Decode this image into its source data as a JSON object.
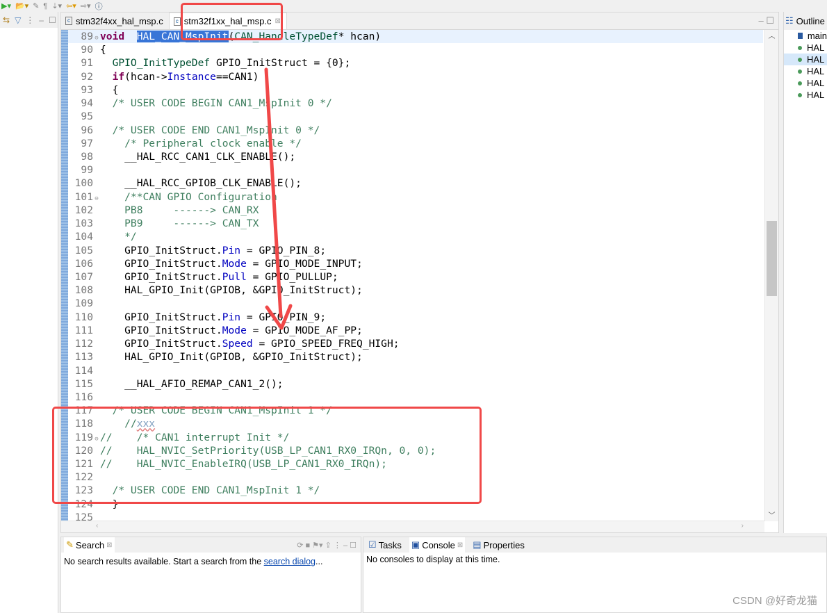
{
  "editor": {
    "tabs": [
      {
        "label": "stm32f4xx_hal_msp.c",
        "active": false
      },
      {
        "label": "stm32f1xx_hal_msp.c",
        "active": true
      }
    ],
    "current_line": 89,
    "lines": [
      {
        "n": "89",
        "fold": true,
        "t": [
          [
            "kw",
            "void"
          ],
          [
            "",
            "  "
          ],
          [
            "sel",
            "HAL_CAN_MspInit"
          ],
          [
            "",
            "("
          ],
          [
            "typ",
            "CAN_HandleTypeDef"
          ],
          [
            "",
            "* hcan)"
          ]
        ]
      },
      {
        "n": "90",
        "t": [
          [
            "",
            "{"
          ]
        ]
      },
      {
        "n": "91",
        "t": [
          [
            "",
            "  "
          ],
          [
            "typ",
            "GPIO_InitTypeDef"
          ],
          [
            "",
            " GPIO_InitStruct = {0};"
          ]
        ]
      },
      {
        "n": "92",
        "t": [
          [
            "",
            "  "
          ],
          [
            "kw",
            "if"
          ],
          [
            "",
            "(hcan->"
          ],
          [
            "fld",
            "Instance"
          ],
          [
            "",
            "==CAN1)"
          ]
        ]
      },
      {
        "n": "93",
        "t": [
          [
            "",
            "  {"
          ]
        ]
      },
      {
        "n": "94",
        "t": [
          [
            "",
            "  "
          ],
          [
            "cm",
            "/* USER CODE BEGIN CAN1_MspInit 0 */"
          ]
        ]
      },
      {
        "n": "95",
        "t": []
      },
      {
        "n": "96",
        "t": [
          [
            "",
            "  "
          ],
          [
            "cm",
            "/* USER CODE END CAN1_MspInit 0 */"
          ]
        ]
      },
      {
        "n": "97",
        "t": [
          [
            "",
            "    "
          ],
          [
            "cm",
            "/* Peripheral clock enable */"
          ]
        ]
      },
      {
        "n": "98",
        "t": [
          [
            "",
            "    __HAL_RCC_CAN1_CLK_ENABLE();"
          ]
        ]
      },
      {
        "n": "99",
        "t": []
      },
      {
        "n": "100",
        "t": [
          [
            "",
            "    __HAL_RCC_GPIOB_CLK_ENABLE();"
          ]
        ]
      },
      {
        "n": "101",
        "fold": true,
        "t": [
          [
            "",
            "    "
          ],
          [
            "cm",
            "/**CAN GPIO Configuration"
          ]
        ]
      },
      {
        "n": "102",
        "t": [
          [
            "cm",
            "    PB8     ------> CAN_RX"
          ]
        ]
      },
      {
        "n": "103",
        "t": [
          [
            "cm",
            "    PB9     ------> CAN_TX"
          ]
        ]
      },
      {
        "n": "104",
        "t": [
          [
            "cm",
            "    */"
          ]
        ]
      },
      {
        "n": "105",
        "t": [
          [
            "",
            "    GPIO_InitStruct."
          ],
          [
            "fld",
            "Pin"
          ],
          [
            "",
            " = GPIO_PIN_8;"
          ]
        ]
      },
      {
        "n": "106",
        "t": [
          [
            "",
            "    GPIO_InitStruct."
          ],
          [
            "fld",
            "Mode"
          ],
          [
            "",
            " = GPIO_MODE_INPUT;"
          ]
        ]
      },
      {
        "n": "107",
        "t": [
          [
            "",
            "    GPIO_InitStruct."
          ],
          [
            "fld",
            "Pull"
          ],
          [
            "",
            " = GPIO_PULLUP;"
          ]
        ]
      },
      {
        "n": "108",
        "t": [
          [
            "",
            "    HAL_GPIO_Init(GPIOB, &GPIO_InitStruct);"
          ]
        ]
      },
      {
        "n": "109",
        "t": []
      },
      {
        "n": "110",
        "t": [
          [
            "",
            "    GPIO_InitStruct."
          ],
          [
            "fld",
            "Pin"
          ],
          [
            "",
            " = GPIO_PIN_9;"
          ]
        ]
      },
      {
        "n": "111",
        "t": [
          [
            "",
            "    GPIO_InitStruct."
          ],
          [
            "fld",
            "Mode"
          ],
          [
            "",
            " = GPIO_MODE_AF_PP;"
          ]
        ]
      },
      {
        "n": "112",
        "t": [
          [
            "",
            "    GPIO_InitStruct."
          ],
          [
            "fld",
            "Speed"
          ],
          [
            "",
            " = GPIO_SPEED_FREQ_HIGH;"
          ]
        ]
      },
      {
        "n": "113",
        "t": [
          [
            "",
            "    HAL_GPIO_Init(GPIOB, &GPIO_InitStruct);"
          ]
        ]
      },
      {
        "n": "114",
        "t": []
      },
      {
        "n": "115",
        "t": [
          [
            "",
            "    __HAL_AFIO_REMAP_CAN1_2();"
          ]
        ]
      },
      {
        "n": "116",
        "t": []
      },
      {
        "n": "117",
        "t": [
          [
            "",
            "  "
          ],
          [
            "cm",
            "/* USER CODE BEGIN CAN1_MspInit 1 */"
          ]
        ]
      },
      {
        "n": "118",
        "t": [
          [
            "",
            "    "
          ],
          [
            "cm",
            "//"
          ],
          [
            "task",
            "xxx"
          ]
        ]
      },
      {
        "n": "119",
        "fold": true,
        "t": [
          [
            "cm",
            "//    /* CAN1 interrupt Init */"
          ]
        ]
      },
      {
        "n": "120",
        "t": [
          [
            "cm",
            "//    HAL_NVIC_SetPriority(USB_LP_CAN1_RX0_IRQn, 0, 0);"
          ]
        ]
      },
      {
        "n": "121",
        "t": [
          [
            "cm",
            "//    HAL_NVIC_EnableIRQ(USB_LP_CAN1_RX0_IRQn);"
          ]
        ]
      },
      {
        "n": "122",
        "t": []
      },
      {
        "n": "123",
        "t": [
          [
            "",
            "  "
          ],
          [
            "cm",
            "/* USER CODE END CAN1_MspInit 1 */"
          ]
        ]
      },
      {
        "n": "124",
        "t": [
          [
            "",
            "  }"
          ]
        ]
      },
      {
        "n": "125",
        "t": []
      }
    ]
  },
  "outline": {
    "title": "Outline",
    "items": [
      {
        "label": "main",
        "icon": "include-icon"
      },
      {
        "label": "HAL",
        "icon": "function-icon"
      },
      {
        "label": "HAL",
        "icon": "function-icon",
        "selected": true
      },
      {
        "label": "HAL",
        "icon": "function-icon"
      },
      {
        "label": "HAL",
        "icon": "function-icon"
      },
      {
        "label": "HAL",
        "icon": "function-icon"
      }
    ]
  },
  "search_panel": {
    "tab": "Search",
    "message": "No search results available. Start a search from the ",
    "link": "search dialog",
    "suffix": "..."
  },
  "console_panel": {
    "tabs": [
      "Tasks",
      "Console",
      "Properties"
    ],
    "message": "No consoles to display at this time."
  },
  "watermark": "CSDN @好奇龙猫",
  "colors": {
    "annotation": "#f04848",
    "selection": "#3875d7",
    "keyword": "#7f0055",
    "comment": "#3f7f5f",
    "field": "#0000c0"
  }
}
